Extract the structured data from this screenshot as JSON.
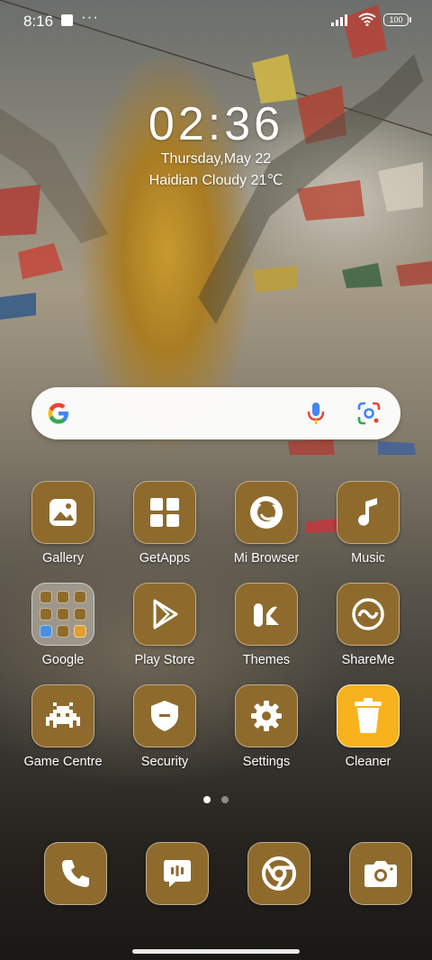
{
  "status_bar": {
    "time": "8:16",
    "battery": "100"
  },
  "clock_widget": {
    "time": "02:36",
    "date": "Thursday,May 22",
    "weather": "Haidian Cloudy 21℃"
  },
  "search": {
    "logo": "google-g-icon",
    "mic": "mic-icon",
    "lens": "google-lens-icon"
  },
  "apps": [
    {
      "label": "Gallery",
      "icon": "gallery-icon"
    },
    {
      "label": "GetApps",
      "icon": "grid-icon"
    },
    {
      "label": "Mi Browser",
      "icon": "browser-icon"
    },
    {
      "label": "Music",
      "icon": "music-note-icon"
    },
    {
      "label": "Google",
      "icon": "folder-icon"
    },
    {
      "label": "Play Store",
      "icon": "play-store-icon"
    },
    {
      "label": "Themes",
      "icon": "themes-icon"
    },
    {
      "label": "ShareMe",
      "icon": "shareme-icon"
    },
    {
      "label": "Game Centre",
      "icon": "game-invader-icon"
    },
    {
      "label": "Security",
      "icon": "shield-icon"
    },
    {
      "label": "Settings",
      "icon": "gear-icon"
    },
    {
      "label": "Cleaner",
      "icon": "trash-icon"
    }
  ],
  "page_indicator": {
    "pages": 2,
    "current": 1
  },
  "dock": [
    {
      "icon": "phone-icon"
    },
    {
      "icon": "messages-icon"
    },
    {
      "icon": "chrome-icon"
    },
    {
      "icon": "camera-icon"
    }
  ],
  "colors": {
    "icon_bg": "#8e6b2c",
    "cleaner_bg": "#f8b21d",
    "search_bg": "#ffffff"
  }
}
